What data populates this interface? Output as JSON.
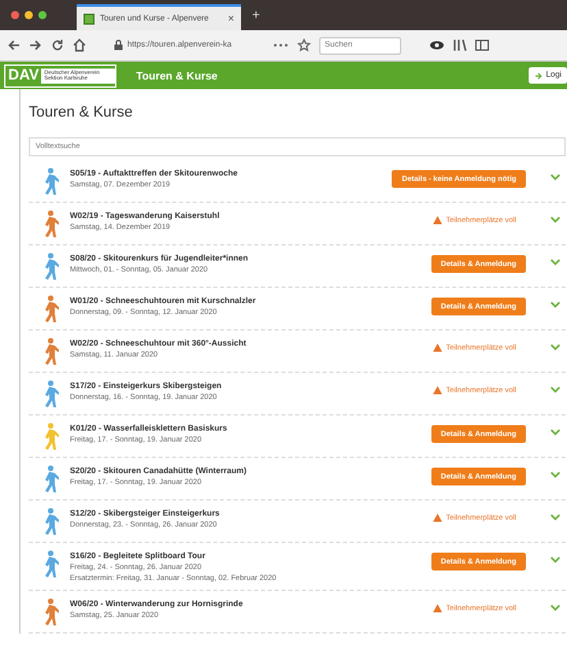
{
  "browser": {
    "tab_title": "Touren und Kurse - Alpenvere",
    "tab_close": "×",
    "new_tab": "+",
    "url": "https://touren.alpenverein-ka",
    "search_placeholder": "Suchen"
  },
  "header": {
    "logo": "DAV",
    "section_name": "Deutscher Alpenverein Sektion Karlsruhe",
    "title": "Touren & Kurse",
    "login": "Logi"
  },
  "heading": "Touren & Kurse",
  "filter": {
    "placeholder": "Volltextsuche"
  },
  "tours": [
    {
      "title": "S05/19 - Auftakttreffen der Skitourenwoche",
      "dates": [
        "Samstag, 07. Dezember 2019"
      ],
      "color": "#5aa9e0",
      "action": {
        "kind": "button",
        "label": "Details - keine Anmeldung nötig"
      }
    },
    {
      "title": "W02/19 - Tageswanderung Kaiserstuhl",
      "dates": [
        "Samstag, 14. Dezember 2019"
      ],
      "color": "#e0803a",
      "action": {
        "kind": "full",
        "label": "Teilnehmerplätze voll"
      }
    },
    {
      "title": "S08/20 - Skitourenkurs für Jugendleiter*innen",
      "dates": [
        "Mittwoch, 01. - Sonntag, 05. Januar 2020"
      ],
      "color": "#5aa9e0",
      "action": {
        "kind": "button",
        "label": "Details & Anmeldung"
      }
    },
    {
      "title": "W01/20 - Schneeschuhtouren mit Kurschnalzler",
      "dates": [
        "Donnerstag, 09. - Sonntag, 12. Januar 2020"
      ],
      "color": "#e0803a",
      "action": {
        "kind": "button",
        "label": "Details & Anmeldung"
      }
    },
    {
      "title": "W02/20 - Schneeschuhtour mit 360°-Aussicht",
      "dates": [
        "Samstag, 11. Januar 2020"
      ],
      "color": "#e0803a",
      "action": {
        "kind": "full",
        "label": "Teilnehmerplätze voll"
      }
    },
    {
      "title": "S17/20 - Einsteigerkurs Skibergsteigen",
      "dates": [
        "Donnerstag, 16. - Sonntag, 19. Januar 2020"
      ],
      "color": "#5aa9e0",
      "action": {
        "kind": "full",
        "label": "Teilnehmerplätze voll"
      }
    },
    {
      "title": "K01/20 - Wasserfalleisklettern Basiskurs",
      "dates": [
        "Freitag, 17. - Sonntag, 19. Januar 2020"
      ],
      "color": "#f2c12e",
      "action": {
        "kind": "button",
        "label": "Details & Anmeldung"
      }
    },
    {
      "title": "S20/20 - Skitouren Canadahütte (Winterraum)",
      "dates": [
        "Freitag, 17. - Sonntag, 19. Januar 2020"
      ],
      "color": "#5aa9e0",
      "action": {
        "kind": "button",
        "label": "Details & Anmeldung"
      }
    },
    {
      "title": "S12/20 - Skibergsteiger Einsteigerkurs",
      "dates": [
        "Donnerstag, 23. - Sonntag, 26. Januar 2020"
      ],
      "color": "#5aa9e0",
      "action": {
        "kind": "full",
        "label": "Teilnehmerplätze voll"
      }
    },
    {
      "title": "S16/20 - Begleitete Splitboard Tour",
      "dates": [
        "Freitag, 24. - Sonntag, 26. Januar 2020",
        "Ersatztermin: Freitag, 31. Januar - Sonntag, 02. Februar 2020"
      ],
      "color": "#5aa9e0",
      "action": {
        "kind": "button",
        "label": "Details & Anmeldung"
      }
    },
    {
      "title": "W06/20 - Winterwanderung zur Hornisgrinde",
      "dates": [
        "Samstag, 25. Januar 2020"
      ],
      "color": "#e0803a",
      "action": {
        "kind": "full",
        "label": "Teilnehmerplätze voll"
      }
    }
  ]
}
